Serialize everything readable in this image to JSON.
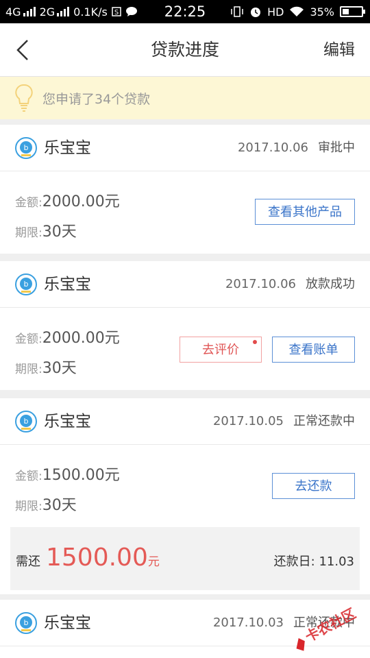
{
  "status_bar": {
    "net1": "4G",
    "net2": "2G",
    "speed": "0.1K/s",
    "time": "22:25",
    "hd": "HD",
    "battery": "35%",
    "battery_level": 0.35
  },
  "header": {
    "title": "贷款进度",
    "edit_label": "编辑"
  },
  "notice": {
    "text": "您申请了34个贷款"
  },
  "loans": [
    {
      "name": "乐宝宝",
      "date": "2017.10.06",
      "status": "审批中",
      "amount_label": "金额:",
      "amount": "2000.00元",
      "term_label": "期限:",
      "term": "30天",
      "buttons": [
        "查看其他产品"
      ]
    },
    {
      "name": "乐宝宝",
      "date": "2017.10.06",
      "status": "放款成功",
      "amount_label": "金额:",
      "amount": "2000.00元",
      "term_label": "期限:",
      "term": "30天",
      "buttons": [
        "去评价",
        "查看账单"
      ]
    },
    {
      "name": "乐宝宝",
      "date": "2017.10.05",
      "status": "正常还款中",
      "amount_label": "金额:",
      "amount": "1500.00元",
      "term_label": "期限:",
      "term": "30天",
      "buttons": [
        "去还款"
      ],
      "repay": {
        "label": "需还",
        "amount": "1500.00",
        "unit": "元",
        "due": "还款日: 11.03"
      }
    },
    {
      "name": "乐宝宝",
      "date": "2017.10.03",
      "status": "正常还款中"
    }
  ],
  "watermark": "卡农社区",
  "colors": {
    "accent_blue": "#3a74c9",
    "accent_red": "#e45a56",
    "notice_bg": "#fdf7d5"
  }
}
